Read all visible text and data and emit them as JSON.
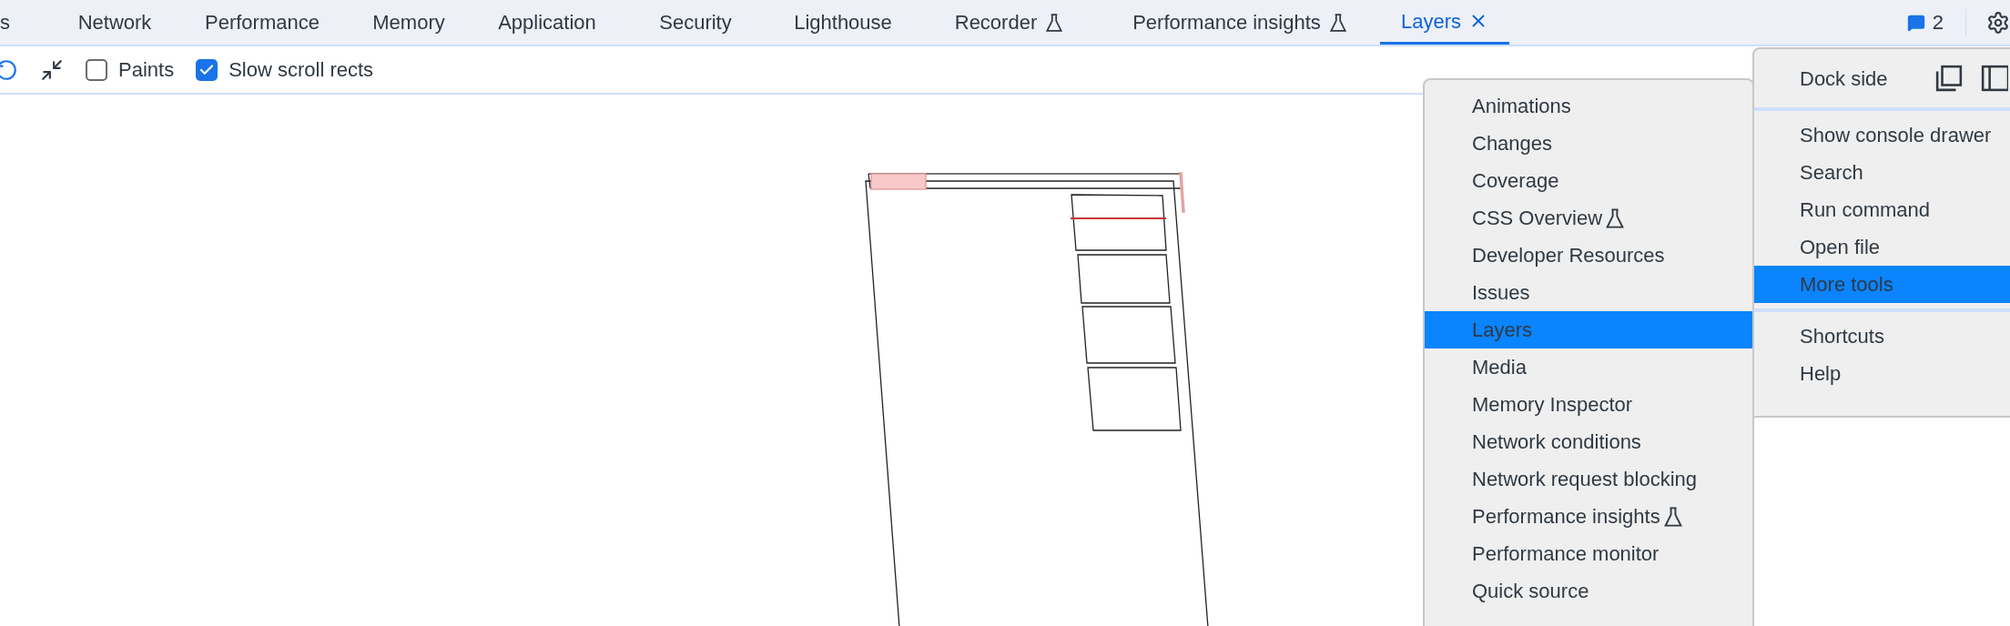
{
  "tabs": [
    {
      "label": "s",
      "selected": false,
      "experimental": false,
      "closable": false
    },
    {
      "label": "Network",
      "selected": false,
      "experimental": false,
      "closable": false
    },
    {
      "label": "Performance",
      "selected": false,
      "experimental": false,
      "closable": false
    },
    {
      "label": "Memory",
      "selected": false,
      "experimental": false,
      "closable": false
    },
    {
      "label": "Application",
      "selected": false,
      "experimental": false,
      "closable": false
    },
    {
      "label": "Security",
      "selected": false,
      "experimental": false,
      "closable": false
    },
    {
      "label": "Lighthouse",
      "selected": false,
      "experimental": false,
      "closable": false
    },
    {
      "label": "Recorder",
      "selected": false,
      "experimental": true,
      "closable": false
    },
    {
      "label": "Performance insights",
      "selected": false,
      "experimental": true,
      "closable": false
    },
    {
      "label": "Layers",
      "selected": true,
      "experimental": false,
      "closable": true
    }
  ],
  "issues_count": "2",
  "toolbar": {
    "checkboxes": [
      {
        "label": "Paints",
        "checked": false
      },
      {
        "label": "Slow scroll rects",
        "checked": true
      }
    ]
  },
  "more_tools_menu": [
    {
      "label": "Animations",
      "selected": false,
      "experimental": false
    },
    {
      "label": "Changes",
      "selected": false,
      "experimental": false
    },
    {
      "label": "Coverage",
      "selected": false,
      "experimental": false
    },
    {
      "label": "CSS Overview",
      "selected": false,
      "experimental": true
    },
    {
      "label": "Developer Resources",
      "selected": false,
      "experimental": false
    },
    {
      "label": "Issues",
      "selected": false,
      "experimental": false
    },
    {
      "label": "Layers",
      "selected": true,
      "experimental": false
    },
    {
      "label": "Media",
      "selected": false,
      "experimental": false
    },
    {
      "label": "Memory Inspector",
      "selected": false,
      "experimental": false
    },
    {
      "label": "Network conditions",
      "selected": false,
      "experimental": false
    },
    {
      "label": "Network request blocking",
      "selected": false,
      "experimental": false
    },
    {
      "label": "Performance insights",
      "selected": false,
      "experimental": true
    },
    {
      "label": "Performance monitor",
      "selected": false,
      "experimental": false
    },
    {
      "label": "Quick source",
      "selected": false,
      "experimental": false
    }
  ],
  "main_menu": {
    "dock_side": {
      "label": "Dock side"
    },
    "sections": [
      [
        {
          "label": "Show console drawer",
          "selected": false
        },
        {
          "label": "Search",
          "selected": false
        },
        {
          "label": "Run command",
          "selected": false
        },
        {
          "label": "Open file",
          "selected": false
        },
        {
          "label": "More tools",
          "selected": true
        }
      ],
      [
        {
          "label": "Shortcuts",
          "selected": false
        },
        {
          "label": "Help",
          "selected": false
        }
      ]
    ]
  }
}
